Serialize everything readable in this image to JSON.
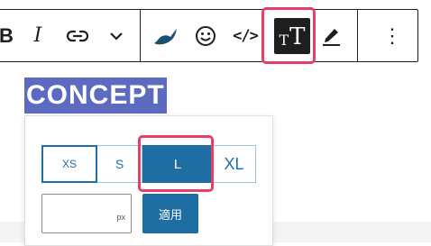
{
  "toolbar": {
    "bold_glyph": "B",
    "italic_glyph": "I",
    "code_glyph": "</>",
    "more_glyph": "⋮",
    "active_tool": "text-size"
  },
  "heading": {
    "text": "CONCEPT"
  },
  "font_size_panel": {
    "sizes": [
      {
        "label": "XS"
      },
      {
        "label": "S"
      },
      {
        "label": "L",
        "selected": true
      },
      {
        "label": "XL"
      }
    ],
    "custom_size": {
      "value": "",
      "unit": "px"
    },
    "apply_label": "適用"
  },
  "colors": {
    "accent": "#1f6ea3",
    "highlight_frame": "#e83e6a",
    "selection": "#5c6bc0"
  }
}
